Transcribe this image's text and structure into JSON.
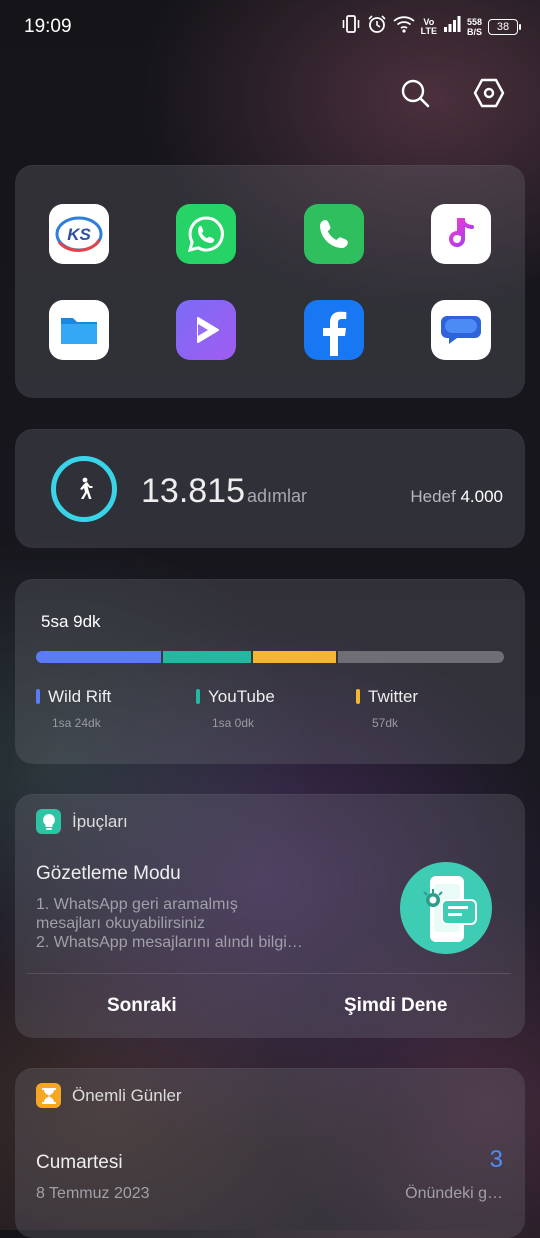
{
  "status_bar": {
    "time": "19:09",
    "network_volte": "Vo",
    "network_lte": "LTE",
    "speed_value": "558",
    "speed_unit": "B/S",
    "battery": "38",
    "icons": [
      "vibrate-icon",
      "alarm-icon",
      "wifi-icon",
      "signal-icon",
      "battery-icon"
    ]
  },
  "top_actions": {
    "icons": [
      "search-icon",
      "settings-hexagon-icon"
    ]
  },
  "apps_widget": {
    "apps": [
      {
        "name": "ks-app",
        "color": "#ffffff"
      },
      {
        "name": "whatsapp",
        "color": "#25d366"
      },
      {
        "name": "phone",
        "color": "#2fbf5f"
      },
      {
        "name": "music",
        "color": "#ffffff"
      },
      {
        "name": "files",
        "color": "#ffffff"
      },
      {
        "name": "video-player",
        "color": "#8b5cf6"
      },
      {
        "name": "facebook",
        "color": "#1877f2"
      },
      {
        "name": "messages",
        "color": "#ffffff"
      }
    ],
    "ks_label": "KS"
  },
  "steps_widget": {
    "count": "13.815",
    "unit": "adımlar",
    "goal_label": "Hedef",
    "goal_value": "4.000",
    "ring_color": "#3ad4e8"
  },
  "usage_widget": {
    "total": "5sa  9dk",
    "segments": [
      {
        "label": "Wild Rift",
        "time": "1sa 24dk",
        "color": "#5b7cf6",
        "share": 0.27
      },
      {
        "label": "YouTube",
        "time": "1sa  0dk",
        "color": "#22b9a0",
        "share": 0.19
      },
      {
        "label": "Twitter",
        "time": "57dk",
        "color": "#f5b731",
        "share": 0.18
      },
      {
        "label": "",
        "time": "",
        "color": "#6e6e74",
        "share": 0.36
      }
    ]
  },
  "tips_widget": {
    "header": "İpuçları",
    "title": "Gözetleme Modu",
    "body_line1": "1. WhatsApp geri aramalmış",
    "body_line2": "mesajları okuyabilirsiniz",
    "body_line3": "2. WhatsApp mesajlarını alındı bilgi…",
    "next_button": "Sonraki",
    "try_button": "Şimdi Dene",
    "accent": "#2fc3a4"
  },
  "days_widget": {
    "header": "Önemli Günler",
    "day_name": "Cumartesi",
    "date": "8 Temmuz 2023",
    "count": "3",
    "sub_label": "Önündeki g…",
    "accent": "#f5a623"
  }
}
